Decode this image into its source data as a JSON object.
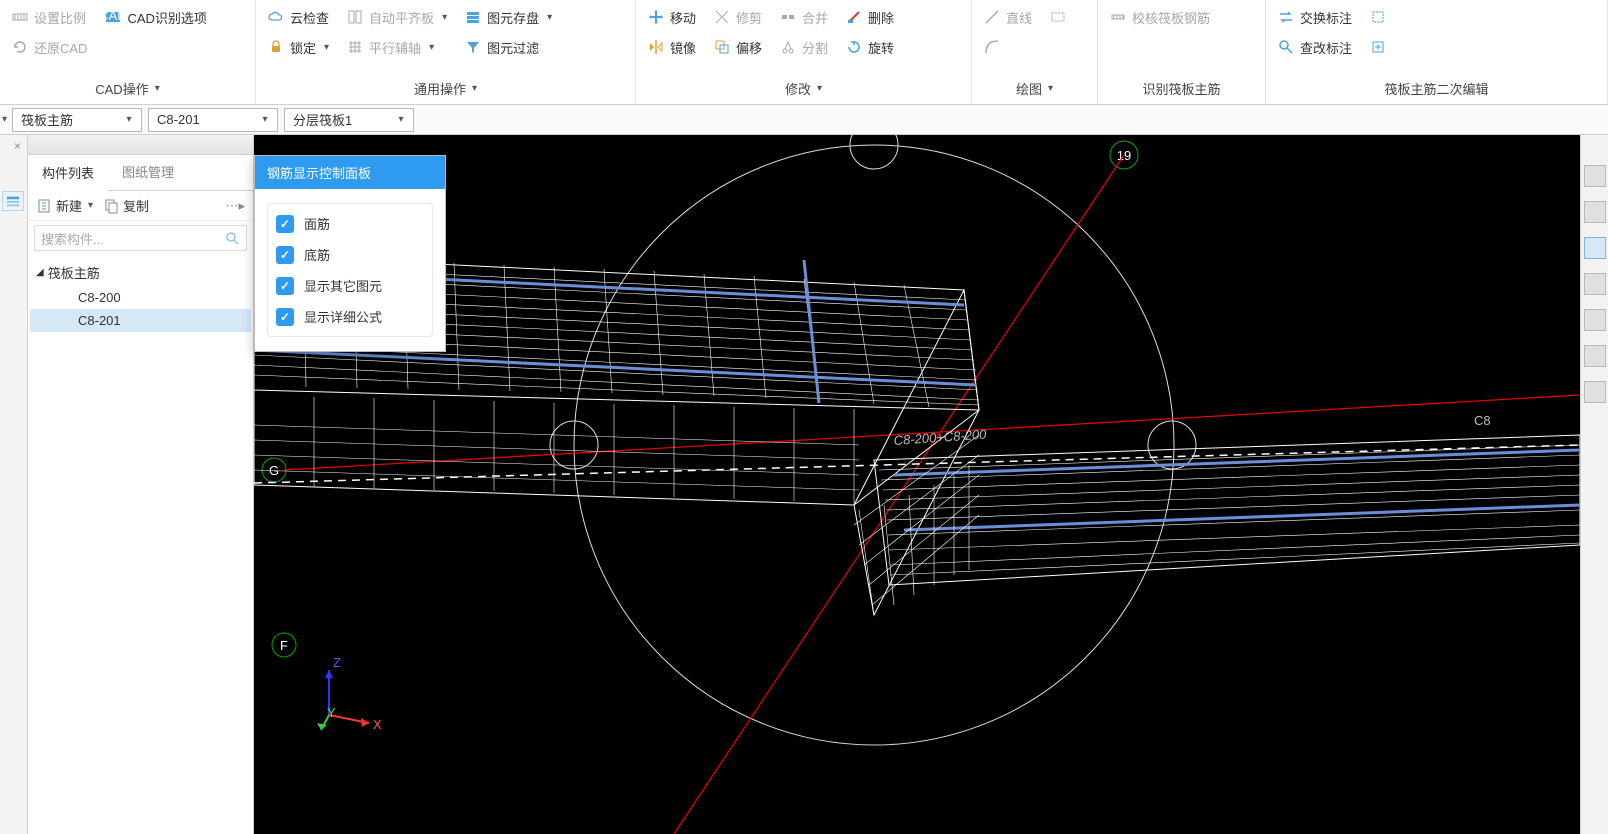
{
  "ribbon": {
    "group1": {
      "label": "CAD操作",
      "set_scale": "设置比例",
      "cad_options": "CAD识别选项",
      "restore_cad": "还原CAD"
    },
    "group2": {
      "label": "通用操作",
      "cloud_check": "云检查",
      "auto_align": "自动平齐板",
      "lock": "锁定",
      "parallel_aux": "平行辅轴",
      "element_storage": "图元存盘",
      "element_filter": "图元过滤"
    },
    "group3": {
      "label": "修改",
      "move": "移动",
      "trim": "修剪",
      "merge": "合并",
      "delete": "删除",
      "mirror": "镜像",
      "offset": "偏移",
      "split": "分割",
      "rotate": "旋转"
    },
    "group4": {
      "label": "绘图",
      "line": "直线",
      "rect": ""
    },
    "group5": {
      "label": "识别筏板主筋",
      "calibrate": "校核筏板钢筋"
    },
    "group6": {
      "label": "筏板主筋二次编辑",
      "swap": "交换标注",
      "modify": "查改标注"
    }
  },
  "combos": {
    "c1": "筏板主筋",
    "c2": "C8-201",
    "c3": "分层筏板1"
  },
  "panel": {
    "tab1": "构件列表",
    "tab2": "图纸管理",
    "new": "新建",
    "copy": "复制",
    "search_ph": "搜索构件...",
    "parent": "筏板主筋",
    "item1": "C8-200",
    "item2": "C8-201"
  },
  "float": {
    "title": "钢筋显示控制面板",
    "opt1": "面筋",
    "opt2": "底筋",
    "opt3": "显示其它图元",
    "opt4": "显示详细公式"
  },
  "axes": {
    "x": "X",
    "y": "Y",
    "z": "Z"
  },
  "markers": {
    "g": "G",
    "f": "F",
    "n19": "19"
  },
  "annotation": "C8-200+C8-200"
}
